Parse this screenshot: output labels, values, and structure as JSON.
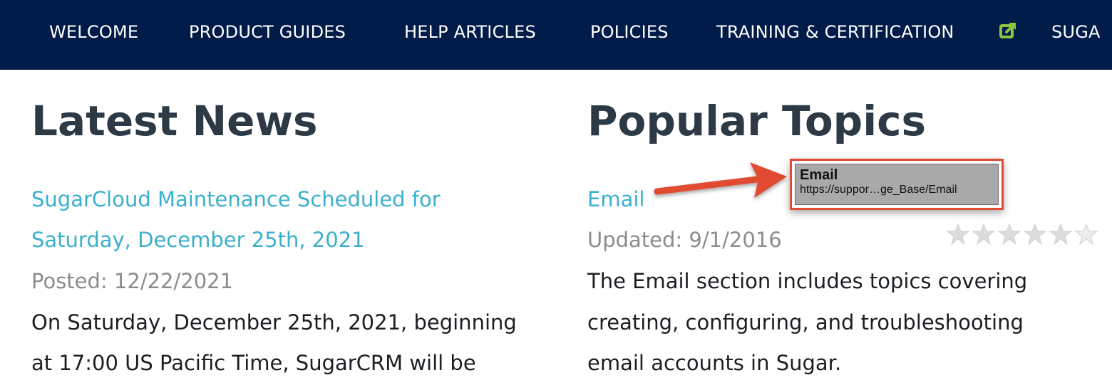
{
  "nav": {
    "items": [
      {
        "label": "WELCOME"
      },
      {
        "label": "PRODUCT GUIDES"
      },
      {
        "label": "HELP ARTICLES"
      },
      {
        "label": "POLICIES"
      },
      {
        "label": "TRAINING & CERTIFICATION"
      },
      {
        "label": "SUGA"
      }
    ],
    "external_icon": "external-link-icon",
    "background": "#011c48",
    "icon_color": "#8cc63f"
  },
  "latest_news": {
    "title": "Latest News",
    "article": {
      "link_line1": "SugarCloud Maintenance Scheduled for",
      "link_line2": "Saturday, December 25th, 2021",
      "posted": "Posted: 12/22/2021",
      "body_line1": "On Saturday, December 25th, 2021, beginning",
      "body_line2": "at 17:00 US Pacific Time, SugarCRM will be"
    }
  },
  "popular_topics": {
    "title": "Popular Topics",
    "topic": {
      "link": "Email",
      "updated": "Updated: 9/1/2016",
      "body_line1": "The Email section includes topics covering",
      "body_line2": "creating, configuring, and troubleshooting",
      "body_line3": "email accounts in Sugar.",
      "rating": 0,
      "rating_max": 6
    }
  },
  "tooltip": {
    "title": "Email",
    "url": "https://suppor…ge_Base/Email"
  },
  "colors": {
    "link": "#3ab0cd",
    "heading": "#2d3a45",
    "meta": "#8c8c8c",
    "annotation": "#e04b33",
    "star_empty": "#dcdcdc"
  }
}
